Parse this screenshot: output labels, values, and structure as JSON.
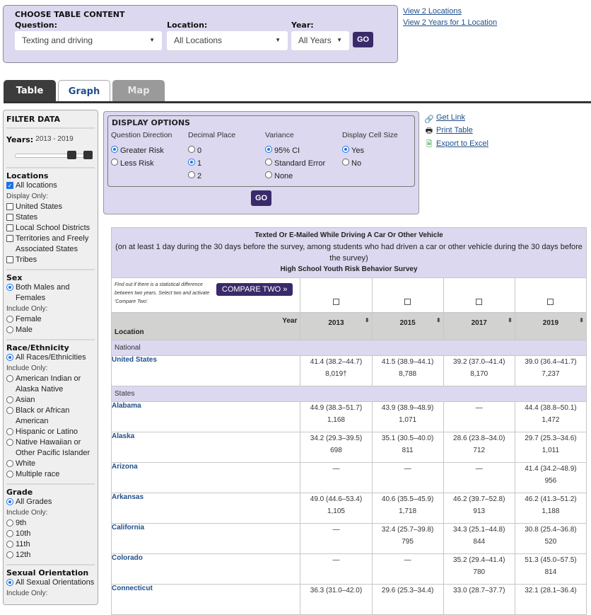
{
  "choose": {
    "title": "CHOOSE TABLE CONTENT",
    "question_label": "Question:",
    "question_value": "Texting and driving",
    "location_label": "Location:",
    "location_value": "All Locations",
    "year_label": "Year:",
    "year_value": "All Years",
    "go": "GO"
  },
  "top_links": [
    "View 2 Locations",
    "View 2 Years for 1 Location"
  ],
  "tabs": [
    "Table",
    "Graph",
    "Map"
  ],
  "filter": {
    "title": "FILTER DATA",
    "years_label": "Years:",
    "years_value": "2013 - 2019",
    "locations": {
      "title": "Locations",
      "all": "All locations",
      "note": "Display Only:",
      "items": [
        "United States",
        "States",
        "Local School Districts",
        "Territories and Freely Associated States",
        "Tribes"
      ]
    },
    "sex": {
      "title": "Sex",
      "all": "Both Males and Females",
      "note": "Include Only:",
      "items": [
        "Female",
        "Male"
      ]
    },
    "race": {
      "title": "Race/Ethnicity",
      "all": "All Races/Ethnicities",
      "note": "Include Only:",
      "items": [
        "American Indian or Alaska Native",
        "Asian",
        "Black or African American",
        "Hispanic or Latino",
        "Native Hawaiian or Other Pacific Islander",
        "White",
        "Multiple race"
      ]
    },
    "grade": {
      "title": "Grade",
      "all": "All Grades",
      "note": "Include Only:",
      "items": [
        "9th",
        "10th",
        "11th",
        "12th"
      ]
    },
    "orientation": {
      "title": "Sexual Orientation",
      "all": "All Sexual Orientations",
      "note": "Include Only:"
    }
  },
  "display": {
    "title": "DISPLAY OPTIONS",
    "direction": {
      "label": "Question Direction",
      "options": [
        "Greater Risk",
        "Less Risk"
      ],
      "selected": 0
    },
    "decimal": {
      "label": "Decimal Place",
      "options": [
        "0",
        "1",
        "2"
      ],
      "selected": 1
    },
    "variance": {
      "label": "Variance",
      "options": [
        "95% CI",
        "Standard Error",
        "None"
      ],
      "selected": 0
    },
    "cellsize": {
      "label": "Display Cell Size",
      "options": [
        "Yes",
        "No"
      ],
      "selected": 0
    },
    "go": "GO"
  },
  "side_links": [
    "Get Link",
    "Print Table",
    "Export to Excel"
  ],
  "table": {
    "title": "Texted Or E-Mailed While Driving A Car Or Other Vehicle",
    "subtitle": "(on at least 1 day during the 30 days before the survey, among students who had driven a car or other vehicle during the 30 days before the survey)",
    "survey": "High School Youth Risk Behavior Survey",
    "compare_note": "Find out if there is a statistical difference between two years. Select two and activate 'Compare Two'.",
    "compare_btn": "COMPARE TWO »",
    "year_label": "Year",
    "location_label": "Location",
    "years": [
      "2013",
      "2015",
      "2017",
      "2019"
    ],
    "groups": [
      {
        "name": "National",
        "rows": [
          {
            "loc": "United States",
            "cells": [
              [
                "41.4 (38.2–44.7)",
                "8,019†"
              ],
              [
                "41.5 (38.9–44.1)",
                "8,788"
              ],
              [
                "39.2 (37.0–41.4)",
                "8,170"
              ],
              [
                "39.0 (36.4–41.7)",
                "7,237"
              ]
            ]
          }
        ]
      },
      {
        "name": "States",
        "rows": [
          {
            "loc": "Alabama",
            "cells": [
              [
                "44.9 (38.3–51.7)",
                "1,168"
              ],
              [
                "43.9 (38.9–48.9)",
                "1,071"
              ],
              [
                "—",
                ""
              ],
              [
                "44.4 (38.8–50.1)",
                "1,472"
              ]
            ]
          },
          {
            "loc": "Alaska",
            "cells": [
              [
                "34.2 (29.3–39.5)",
                "698"
              ],
              [
                "35.1 (30.5–40.0)",
                "811"
              ],
              [
                "28.6 (23.8–34.0)",
                "712"
              ],
              [
                "29.7 (25.3–34.6)",
                "1,011"
              ]
            ]
          },
          {
            "loc": "Arizona",
            "cells": [
              [
                "—",
                ""
              ],
              [
                "—",
                ""
              ],
              [
                "—",
                ""
              ],
              [
                "41.4 (34.2–48.9)",
                "956"
              ]
            ]
          },
          {
            "loc": "Arkansas",
            "cells": [
              [
                "49.0 (44.6–53.4)",
                "1,105"
              ],
              [
                "40.6 (35.5–45.9)",
                "1,718"
              ],
              [
                "46.2 (39.7–52.8)",
                "913"
              ],
              [
                "46.2 (41.3–51.2)",
                "1,188"
              ]
            ]
          },
          {
            "loc": "California",
            "cells": [
              [
                "—",
                ""
              ],
              [
                "32.4 (25.7–39.8)",
                "795"
              ],
              [
                "34.3 (25.1–44.8)",
                "844"
              ],
              [
                "30.8 (25.4–36.8)",
                "520"
              ]
            ]
          },
          {
            "loc": "Colorado",
            "cells": [
              [
                "—",
                ""
              ],
              [
                "—",
                ""
              ],
              [
                "35.2 (29.4–41.4)",
                "780"
              ],
              [
                "51.3 (45.0–57.5)",
                "814"
              ]
            ]
          },
          {
            "loc": "Connecticut",
            "cells": [
              [
                "36.3 (31.0–42.0)",
                ""
              ],
              [
                "29.6 (25.3–34.4)",
                ""
              ],
              [
                "33.0 (28.7–37.7)",
                ""
              ],
              [
                "32.1 (28.1–36.4)",
                ""
              ]
            ]
          }
        ]
      }
    ]
  }
}
